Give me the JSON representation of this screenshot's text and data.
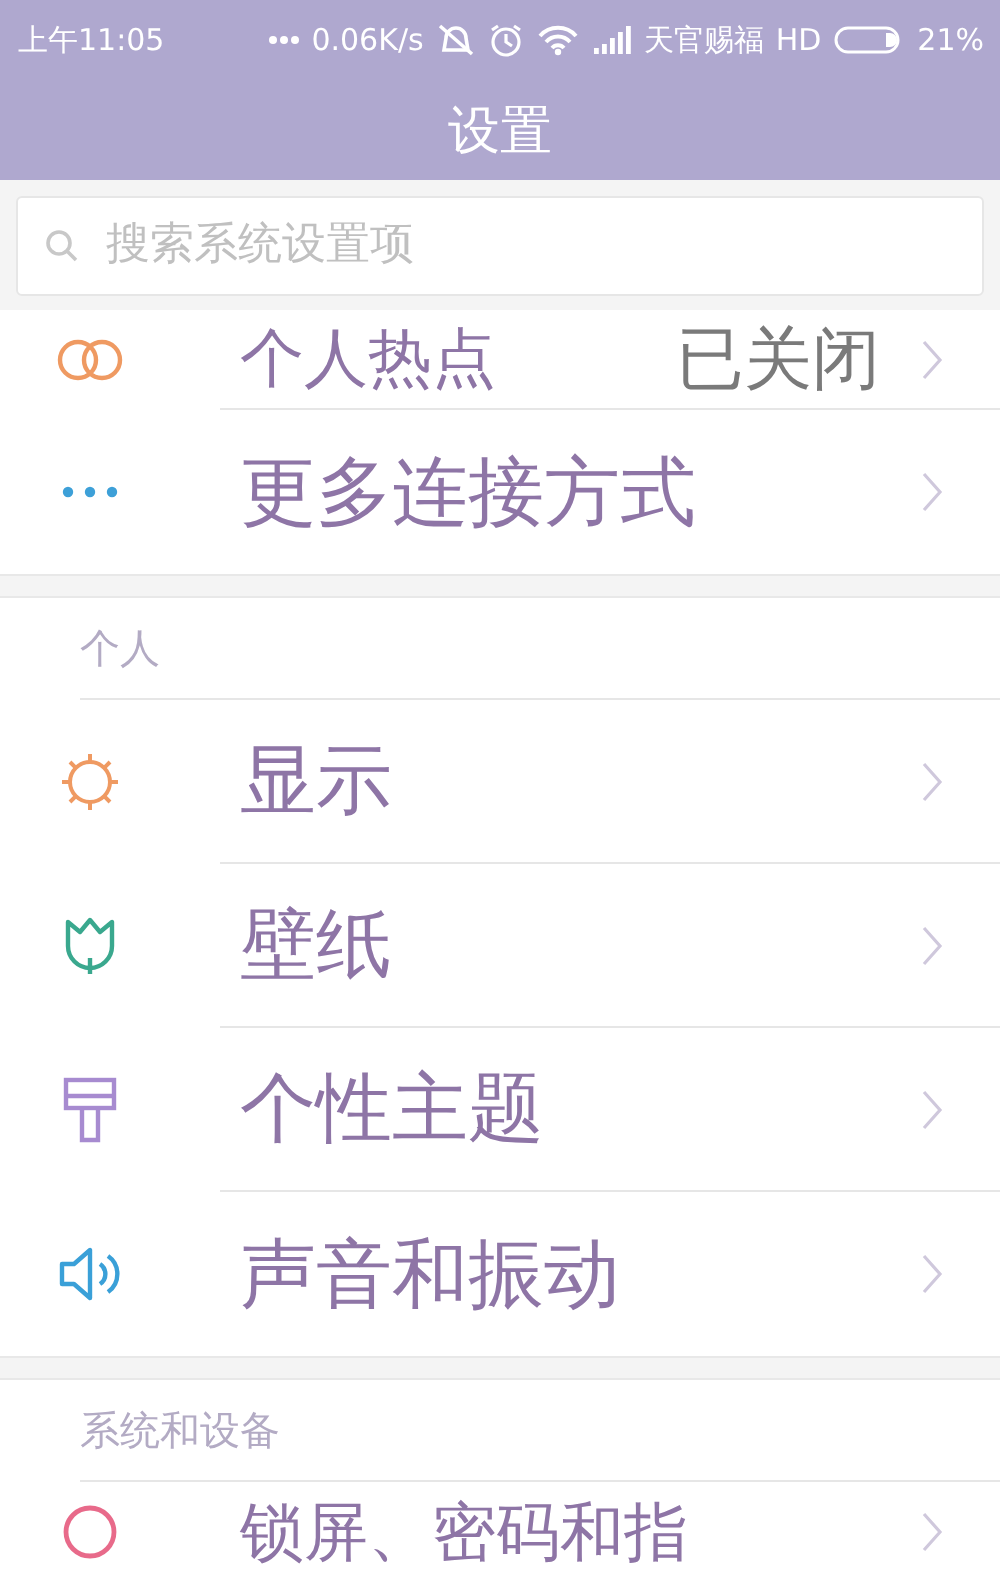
{
  "status_bar": {
    "time": "上午11:05",
    "speed": "0.06K/s",
    "carrier": "天官赐福",
    "network": "HD",
    "battery": "21%"
  },
  "title": "设置",
  "search": {
    "placeholder": "搜索系统设置项"
  },
  "sections": [
    {
      "items": [
        {
          "label": "个人热点",
          "value": "已关闭"
        },
        {
          "label": "更多连接方式"
        }
      ]
    },
    {
      "header": "个人",
      "items": [
        {
          "label": "显示"
        },
        {
          "label": "壁纸"
        },
        {
          "label": "个性主题"
        },
        {
          "label": "声音和振动"
        }
      ]
    },
    {
      "header": "系统和设备",
      "items": [
        {
          "label": "锁屏、密码和指"
        }
      ]
    }
  ]
}
